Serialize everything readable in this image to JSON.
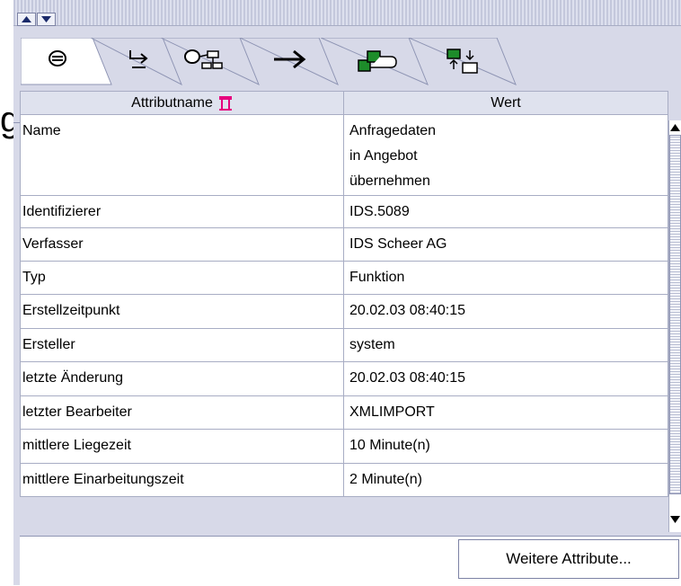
{
  "left_fragment": "g",
  "tabs": [
    {
      "icon": "object-icon"
    },
    {
      "icon": "relation-icon"
    },
    {
      "icon": "hierarchy-icon"
    },
    {
      "icon": "arrow-right-icon"
    },
    {
      "icon": "connected-shapes-icon"
    },
    {
      "icon": "assignment-icon"
    }
  ],
  "table": {
    "headers": {
      "name": "Attributname",
      "value": "Wert"
    },
    "rows": [
      {
        "name": "Name",
        "value_lines": [
          "Anfragedaten",
          "in Angebot",
          "übernehmen"
        ]
      },
      {
        "name": "Identifizierer",
        "value_lines": [
          "IDS.5089"
        ]
      },
      {
        "name": "Verfasser",
        "value_lines": [
          "IDS Scheer AG"
        ]
      },
      {
        "name": "Typ",
        "value_lines": [
          "Funktion"
        ]
      },
      {
        "name": "Erstellzeitpunkt",
        "value_lines": [
          "20.02.03 08:40:15"
        ]
      },
      {
        "name": "Ersteller",
        "value_lines": [
          "system"
        ]
      },
      {
        "name": "letzte Änderung",
        "value_lines": [
          "20.02.03 08:40:15"
        ]
      },
      {
        "name": "letzter Bearbeiter",
        "value_lines": [
          "XMLIMPORT"
        ]
      },
      {
        "name": "mittlere Liegezeit",
        "value_lines": [
          "10 Minute(n)"
        ]
      },
      {
        "name": "mittlere Einarbeitungszeit",
        "value_lines": [
          "2 Minute(n)"
        ]
      }
    ]
  },
  "more_button": "Weitere Attribute...",
  "colors": {
    "accent": "#e6007e",
    "panel": "#d7d9e8",
    "border": "#a8adc4"
  }
}
